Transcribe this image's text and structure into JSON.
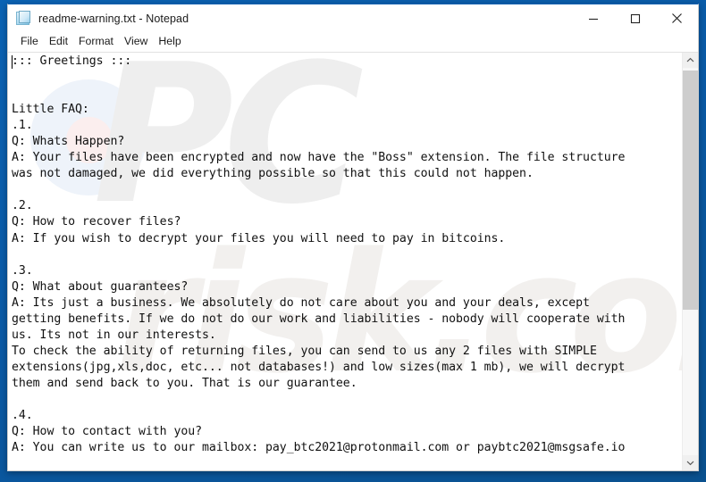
{
  "window": {
    "title": "readme-warning.txt - Notepad",
    "icon": "notepad-document-icon",
    "controls": {
      "minimize_label": "Minimize",
      "maximize_label": "Maximize",
      "close_label": "Close"
    }
  },
  "menubar": {
    "items": [
      {
        "label": "File"
      },
      {
        "label": "Edit"
      },
      {
        "label": "Format"
      },
      {
        "label": "View"
      },
      {
        "label": "Help"
      }
    ]
  },
  "document": {
    "filename": "readme-warning.txt",
    "encrypted_extension": "Boss",
    "contact_emails": [
      "pay_btc2021@protonmail.com",
      "paybtc2021@msgsafe.io"
    ],
    "body": "::: Greetings :::\n\n\nLittle FAQ:\n.1.\nQ: Whats Happen?\nA: Your files have been encrypted and now have the \"Boss\" extension. The file structure\nwas not damaged, we did everything possible so that this could not happen.\n\n.2.\nQ: How to recover files?\nA: If you wish to decrypt your files you will need to pay in bitcoins.\n\n.3.\nQ: What about guarantees?\nA: Its just a business. We absolutely do not care about you and your deals, except\ngetting benefits. If we do not do our work and liabilities - nobody will cooperate with\nus. Its not in our interests.\nTo check the ability of returning files, you can send to us any 2 files with SIMPLE\nextensions(jpg,xls,doc, etc... not databases!) and low sizes(max 1 mb), we will decrypt\nthem and send back to you. That is our guarantee.\n\n.4.\nQ: How to contact with you?\nA: You can write us to our mailbox: pay_btc2021@protonmail.com or paybtc2021@msgsafe.io"
  },
  "scrollbar": {
    "up_arrow": "chevron-up-icon",
    "down_arrow": "chevron-down-icon",
    "thumb_position_percent": 0
  },
  "watermark": {
    "line1": "PC",
    "line2": "risk.com"
  },
  "colors": {
    "desktop_blue": "#0a5ca8",
    "title_accent": "#1060b0",
    "text": "#111111",
    "scrollbar_thumb": "#cdcdcd"
  }
}
